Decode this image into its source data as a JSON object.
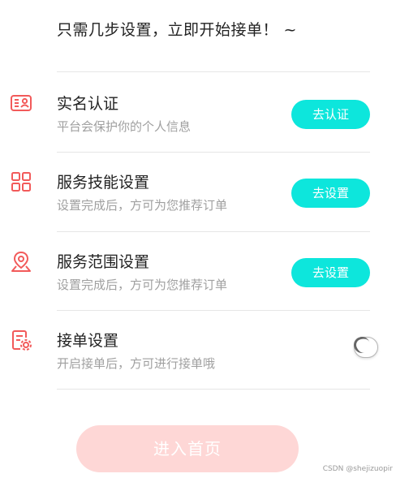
{
  "headline": "只需几步设置，立即开始接单！ ~",
  "colors": {
    "accent": "#0de6dc",
    "icon": "#f25a5a",
    "primary_disabled": "#fed7d6",
    "title": "#222222",
    "subtitle": "#a0a0a0"
  },
  "steps": [
    {
      "icon": "id-card-icon",
      "title": "实名认证",
      "subtitle": "平台会保护你的个人信息",
      "action": "去认证"
    },
    {
      "icon": "grid-icon",
      "title": "服务技能设置",
      "subtitle": "设置完成后，方可为您推荐订单",
      "action": "去设置"
    },
    {
      "icon": "location-pin-icon",
      "title": "服务范围设置",
      "subtitle": "设置完成后，方可为您推荐订单",
      "action": "去设置"
    },
    {
      "icon": "document-settings-icon",
      "title": "接单设置",
      "subtitle": "开启接单后，方可进行接单哦",
      "toggle_on": false
    }
  ],
  "enter_button": "进入首页",
  "watermark": "CSDN @shejizuopir"
}
